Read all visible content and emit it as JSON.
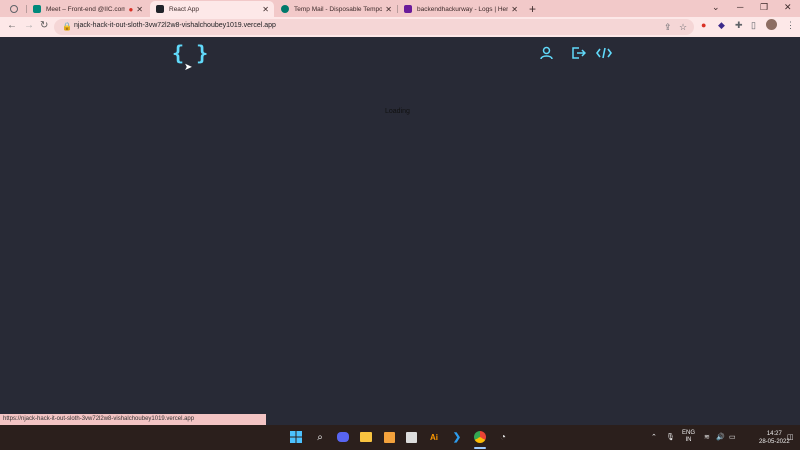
{
  "tabs": [
    {
      "title": "",
      "color": "#5f6368"
    },
    {
      "title": "Meet – Front-end @IIC.com",
      "color": "#00897b",
      "indicator": "●"
    },
    {
      "title": "React App",
      "color": "#20232a",
      "active": true
    },
    {
      "title": "Temp Mail - Disposable Tempo...",
      "color": "#00796b"
    },
    {
      "title": "backendhackurway - Logs | Hero...",
      "color": "#6a1b9a"
    }
  ],
  "close_glyph": "✕",
  "new_tab_glyph": "+",
  "window_controls": {
    "dropdown": "⌄",
    "minimize": "─",
    "restore": "❐",
    "close": "✕"
  },
  "address_bar": {
    "url": "njack-hack-it-out-sloth-3vw72l2w8-vishalchoubey1019.vercel.app"
  },
  "page": {
    "logo": "{ }",
    "loading_text": "Loading"
  },
  "status_bar": {
    "url": "https://njack-hack-it-out-sloth-3vw72l2w8-vishalchoubey1019.vercel.app"
  },
  "tray": {
    "lang_top": "ENG",
    "lang_bottom": "IN",
    "time": "14:27",
    "date": "28-05-2022"
  },
  "colors": {
    "accent": "#61dafb",
    "page_bg": "#282a36",
    "tab_strip": "#f2c9c9"
  }
}
